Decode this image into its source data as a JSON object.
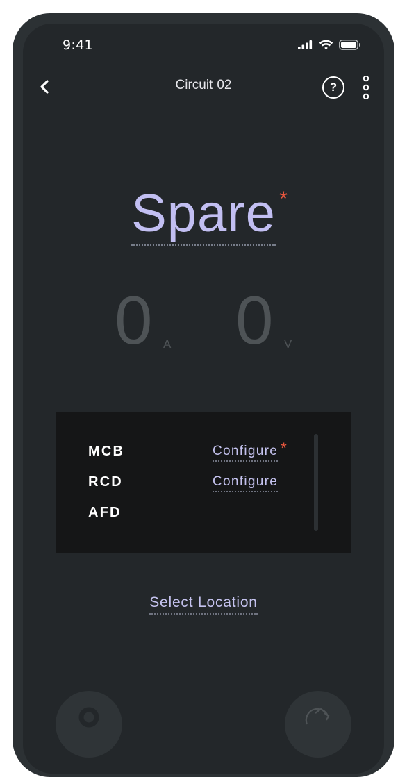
{
  "status_bar": {
    "time": "9:41"
  },
  "header": {
    "title": "Circuit",
    "number": "02",
    "help_label": "?"
  },
  "circuit": {
    "name": "Spare",
    "required_marker": "*"
  },
  "readings": {
    "current_value": "0",
    "current_unit": "A",
    "voltage_value": "0",
    "voltage_unit": "V"
  },
  "protection": {
    "items": [
      {
        "label": "MCB",
        "action": "Configure",
        "required": "*"
      },
      {
        "label": "RCD",
        "action": "Configure"
      },
      {
        "label": "AFD"
      }
    ]
  },
  "location": {
    "label": "Select Location"
  },
  "colors": {
    "background": "#23272a",
    "frame": "#2c3134",
    "accent": "#c2bff2",
    "required": "#e8573e",
    "card": "#151617",
    "dim_text": "#4e5356"
  },
  "icons": [
    "back-chevron-icon",
    "help-icon",
    "more-vertical-icon",
    "signal-icon",
    "wifi-icon",
    "battery-icon",
    "person-icon",
    "sync-icon"
  ]
}
